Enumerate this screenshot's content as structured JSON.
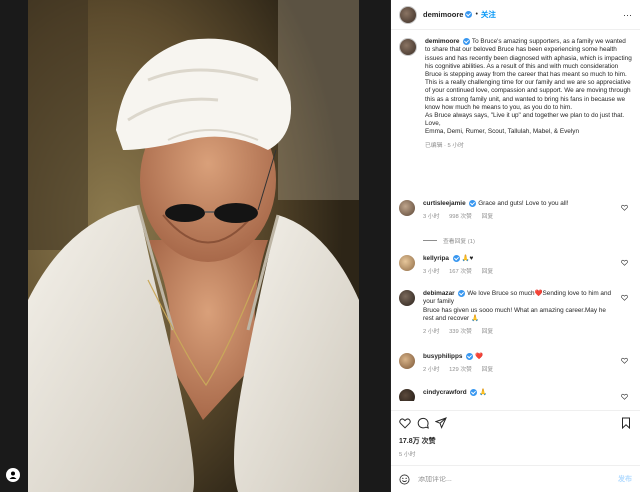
{
  "post": {
    "author": "demimoore",
    "follow_label": "关注",
    "caption_user": "demimoore",
    "caption": "To Bruce's amazing supporters, as a family we wanted to share that our beloved Bruce has been experiencing some health issues and has recently been diagnosed with aphasia, which is impacting his cognitive abilities. As a result of this and with much consideration Bruce is stepping away from the career that has meant so much to him.",
    "caption_p2": "This is a really challenging time for our family and we are so appreciative of your continued love, compassion and support. We are moving through this as a strong family unit, and wanted to bring his fans in because we know how much he means to you, as you do to him.",
    "caption_p3": "As Bruce always says, \"Live it up\" and together we plan to do just that.",
    "caption_p4": "Love,",
    "caption_p5": "Emma, Demi, Rumer, Scout, Tallulah, Mabel, & Evelyn",
    "caption_meta": "已编辑 · 5 小时"
  },
  "comments": [
    {
      "user": "curtisleejamie",
      "text": "Grace and guts! Love to you all!",
      "time": "3 小时",
      "likes": "998 次赞",
      "reply": "回复",
      "replies_label": "查看回复 (1)"
    },
    {
      "user": "kellyripa",
      "text": "🙏♥",
      "time": "3 小时",
      "likes": "167 次赞",
      "reply": "回复"
    },
    {
      "user": "debimazar",
      "text": "We love Bruce so much❤️Sending love to him and your family",
      "text2": "Bruce has given us sooo much! What an amazing career.May he rest and recover 🙏",
      "time": "2 小时",
      "likes": "339 次赞",
      "reply": "回复"
    },
    {
      "user": "busyphilipps",
      "text": "❤️",
      "time": "2 小时",
      "likes": "129 次赞",
      "reply": "回复"
    },
    {
      "user": "cindycrawford",
      "text": "🙏",
      "time": "",
      "likes": "",
      "reply": ""
    }
  ],
  "stats": {
    "likes": "17.8万 次赞",
    "posted": "5 小时"
  },
  "composer": {
    "placeholder": "添加评论...",
    "post_label": "发布"
  },
  "colors": {
    "accent": "#0095f6",
    "verified": "#3897f0",
    "heart": "#ed4956"
  }
}
